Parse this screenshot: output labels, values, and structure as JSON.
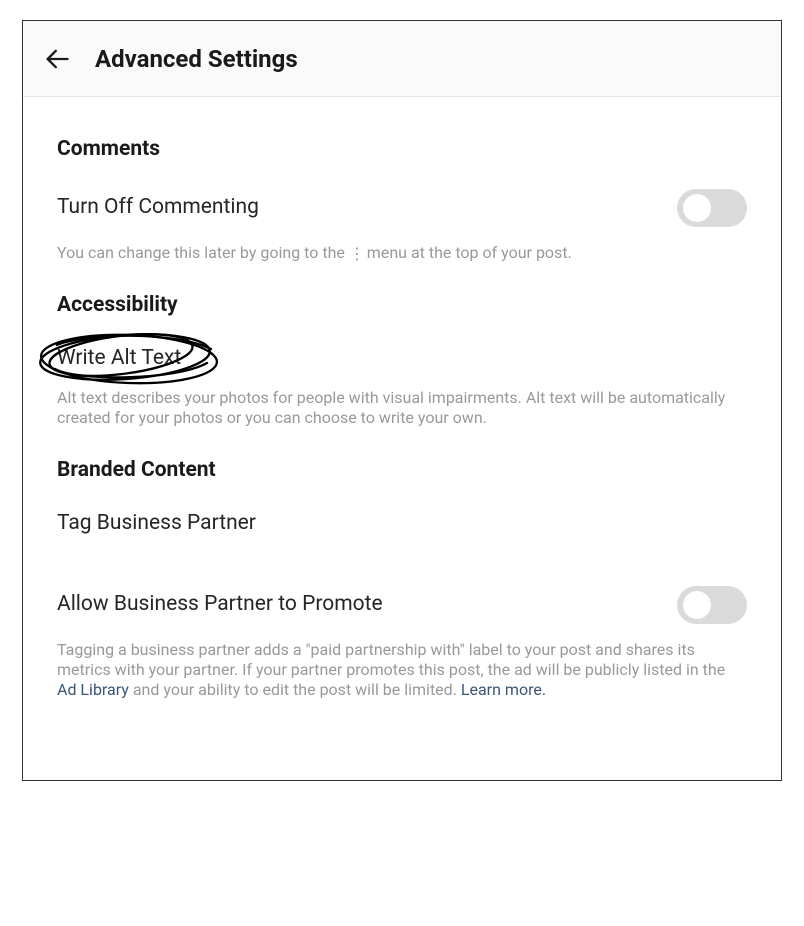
{
  "header": {
    "title": "Advanced Settings"
  },
  "sections": {
    "comments": {
      "heading": "Comments",
      "toggle_label": "Turn Off Commenting",
      "toggle_on": false,
      "helper_before": "You can change this later by going to the ",
      "helper_after": " menu at the top of your post."
    },
    "accessibility": {
      "heading": "Accessibility",
      "alt_text_label": "Write Alt Text",
      "helper": "Alt text describes your photos for people with visual impairments. Alt text will be automatically created for your photos or you can choose to write your own."
    },
    "branded": {
      "heading": "Branded Content",
      "tag_label": "Tag Business Partner",
      "promote_label": "Allow Business Partner to Promote",
      "promote_on": false,
      "helper_part1": "Tagging a business partner adds a \"paid partnership with\" label to your post and shares its metrics with your partner. If your partner promotes this post, the ad will be publicly listed in the ",
      "ad_library": "Ad Library",
      "helper_part2": " and your ability to edit the post will be limited. ",
      "learn_more": "Learn more."
    }
  }
}
